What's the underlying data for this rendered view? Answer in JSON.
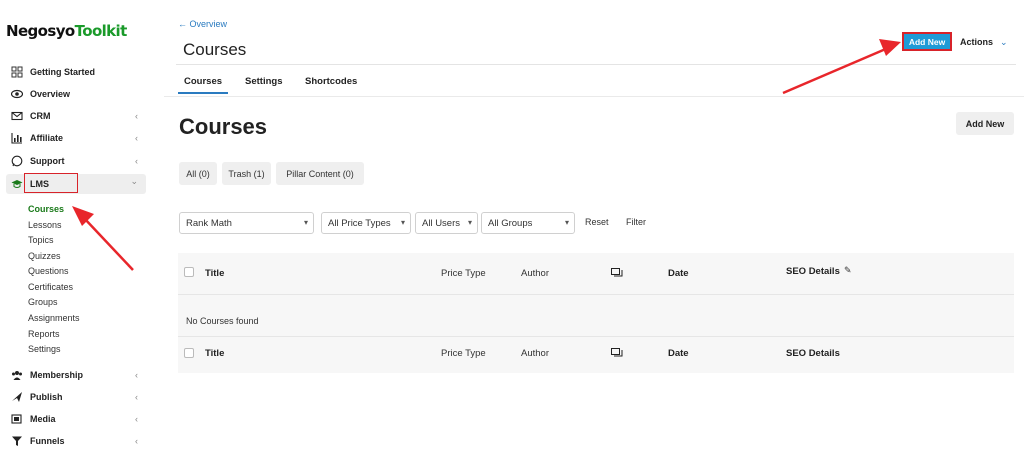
{
  "brand": {
    "logo_part1": "Negosyo",
    "logo_part2": "Toolkit"
  },
  "sidebar": {
    "items": [
      {
        "label": "Getting Started",
        "icon": "grid-icon",
        "chevron": ""
      },
      {
        "label": "Overview",
        "icon": "eye-icon",
        "chevron": ""
      },
      {
        "label": "CRM",
        "icon": "mail-icon",
        "chevron": "‹"
      },
      {
        "label": "Affiliate",
        "icon": "chart-icon",
        "chevron": "‹"
      },
      {
        "label": "Support",
        "icon": "whatsapp-icon",
        "chevron": "‹"
      },
      {
        "label": "LMS",
        "icon": "graduation-cap-icon",
        "chevron": "⌄"
      },
      {
        "label": "Membership",
        "icon": "users-icon",
        "chevron": "‹"
      },
      {
        "label": "Publish",
        "icon": "send-icon",
        "chevron": "‹"
      },
      {
        "label": "Media",
        "icon": "media-icon",
        "chevron": "‹"
      },
      {
        "label": "Funnels",
        "icon": "funnel-icon",
        "chevron": "‹"
      }
    ],
    "lms_sub": [
      "Courses",
      "Lessons",
      "Topics",
      "Quizzes",
      "Questions",
      "Certificates",
      "Groups",
      "Assignments",
      "Reports",
      "Settings"
    ]
  },
  "header": {
    "breadcrumb": "← Overview",
    "title": "Courses",
    "add_new": "Add New",
    "actions": "Actions",
    "actions_chevron": "⌄"
  },
  "tabs": [
    "Courses",
    "Settings",
    "Shortcodes"
  ],
  "main": {
    "title": "Courses",
    "add_new": "Add New",
    "filters": [
      "All (0)",
      "Trash (1)",
      "Pillar Content (0)"
    ],
    "selects": [
      "Rank Math",
      "All Price Types",
      "All Users",
      "All Groups"
    ],
    "reset": "Reset",
    "filter": "Filter"
  },
  "table": {
    "columns": [
      "Title",
      "Price Type",
      "Author",
      "Date",
      "SEO Details"
    ],
    "empty_message": "No Courses found"
  },
  "colors": {
    "accent": "#1e9bd7",
    "brand_green": "#1a9a2a",
    "highlight_red": "#d8232a",
    "link_blue": "#2a7bc0"
  }
}
